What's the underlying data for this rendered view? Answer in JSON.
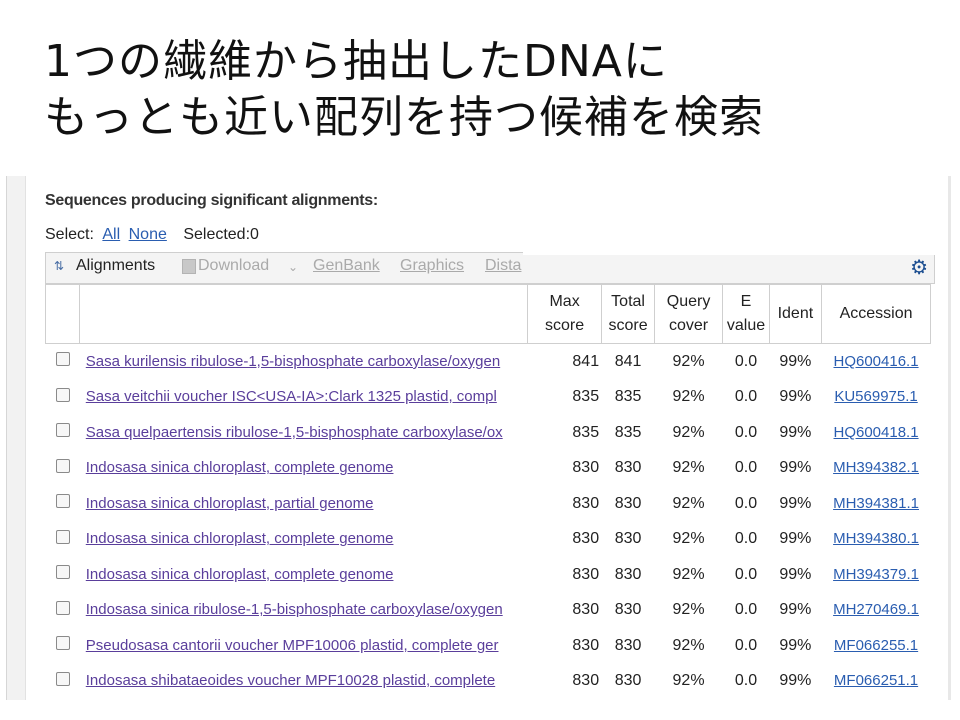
{
  "slide": {
    "title_line1": "1つの繊維から抽出したDNAに",
    "title_line2": "もっとも近い配列を持つ候補を検索"
  },
  "results_section": {
    "heading": "Sequences producing significant alignments:",
    "select_label": "Select:",
    "select_all": "All",
    "select_none": "None",
    "selected_status": "Selected:0"
  },
  "toolbar": {
    "alignments_label": "Alignments",
    "download_label": "Download",
    "genbank_label": "GenBank",
    "graphics_label": "Graphics",
    "distance_label": "Dista"
  },
  "table": {
    "headers": {
      "max_score": [
        "Max",
        "score"
      ],
      "total_score": [
        "Total",
        "score"
      ],
      "query_cover": [
        "Query",
        "cover"
      ],
      "e_value": [
        "E",
        "value"
      ],
      "ident": "Ident",
      "accession": "Accession"
    },
    "rows": [
      {
        "description": "Sasa kurilensis ribulose-1,5-bisphosphate carboxylase/oxygen",
        "max_score": "841",
        "total_score": "841",
        "query_cover": "92%",
        "e_value": "0.0",
        "ident": "99%",
        "accession": "HQ600416.1"
      },
      {
        "description": "Sasa veitchii voucher ISC<USA-IA>:Clark 1325 plastid, compl",
        "max_score": "835",
        "total_score": "835",
        "query_cover": "92%",
        "e_value": "0.0",
        "ident": "99%",
        "accession": "KU569975.1"
      },
      {
        "description": "Sasa quelpaertensis ribulose-1,5-bisphosphate carboxylase/ox",
        "max_score": "835",
        "total_score": "835",
        "query_cover": "92%",
        "e_value": "0.0",
        "ident": "99%",
        "accession": "HQ600418.1"
      },
      {
        "description": "Indosasa sinica chloroplast, complete genome",
        "max_score": "830",
        "total_score": "830",
        "query_cover": "92%",
        "e_value": "0.0",
        "ident": "99%",
        "accession": "MH394382.1"
      },
      {
        "description": "Indosasa sinica chloroplast, partial genome",
        "max_score": "830",
        "total_score": "830",
        "query_cover": "92%",
        "e_value": "0.0",
        "ident": "99%",
        "accession": "MH394381.1"
      },
      {
        "description": "Indosasa sinica chloroplast, complete genome",
        "max_score": "830",
        "total_score": "830",
        "query_cover": "92%",
        "e_value": "0.0",
        "ident": "99%",
        "accession": "MH394380.1"
      },
      {
        "description": "Indosasa sinica chloroplast, complete genome",
        "max_score": "830",
        "total_score": "830",
        "query_cover": "92%",
        "e_value": "0.0",
        "ident": "99%",
        "accession": "MH394379.1"
      },
      {
        "description": "Indosasa sinica ribulose-1,5-bisphosphate carboxylase/oxygen",
        "max_score": "830",
        "total_score": "830",
        "query_cover": "92%",
        "e_value": "0.0",
        "ident": "99%",
        "accession": "MH270469.1"
      },
      {
        "description": "Pseudosasa cantorii voucher MPF10006 plastid, complete ger",
        "max_score": "830",
        "total_score": "830",
        "query_cover": "92%",
        "e_value": "0.0",
        "ident": "99%",
        "accession": "MF066255.1"
      },
      {
        "description": "Indosasa shibataeoides voucher MPF10028 plastid, complete",
        "max_score": "830",
        "total_score": "830",
        "query_cover": "92%",
        "e_value": "0.0",
        "ident": "99%",
        "accession": "MF066251.1"
      }
    ]
  },
  "colors": {
    "link_visited": "#5a3e9b",
    "link": "#2a5db0",
    "gear": "#1d4f91"
  },
  "icons": {
    "alignments": "expand-collapse-arrows-icon",
    "download": "download-icon",
    "dropdown": "chevron-down-icon",
    "settings": "gear-icon"
  }
}
